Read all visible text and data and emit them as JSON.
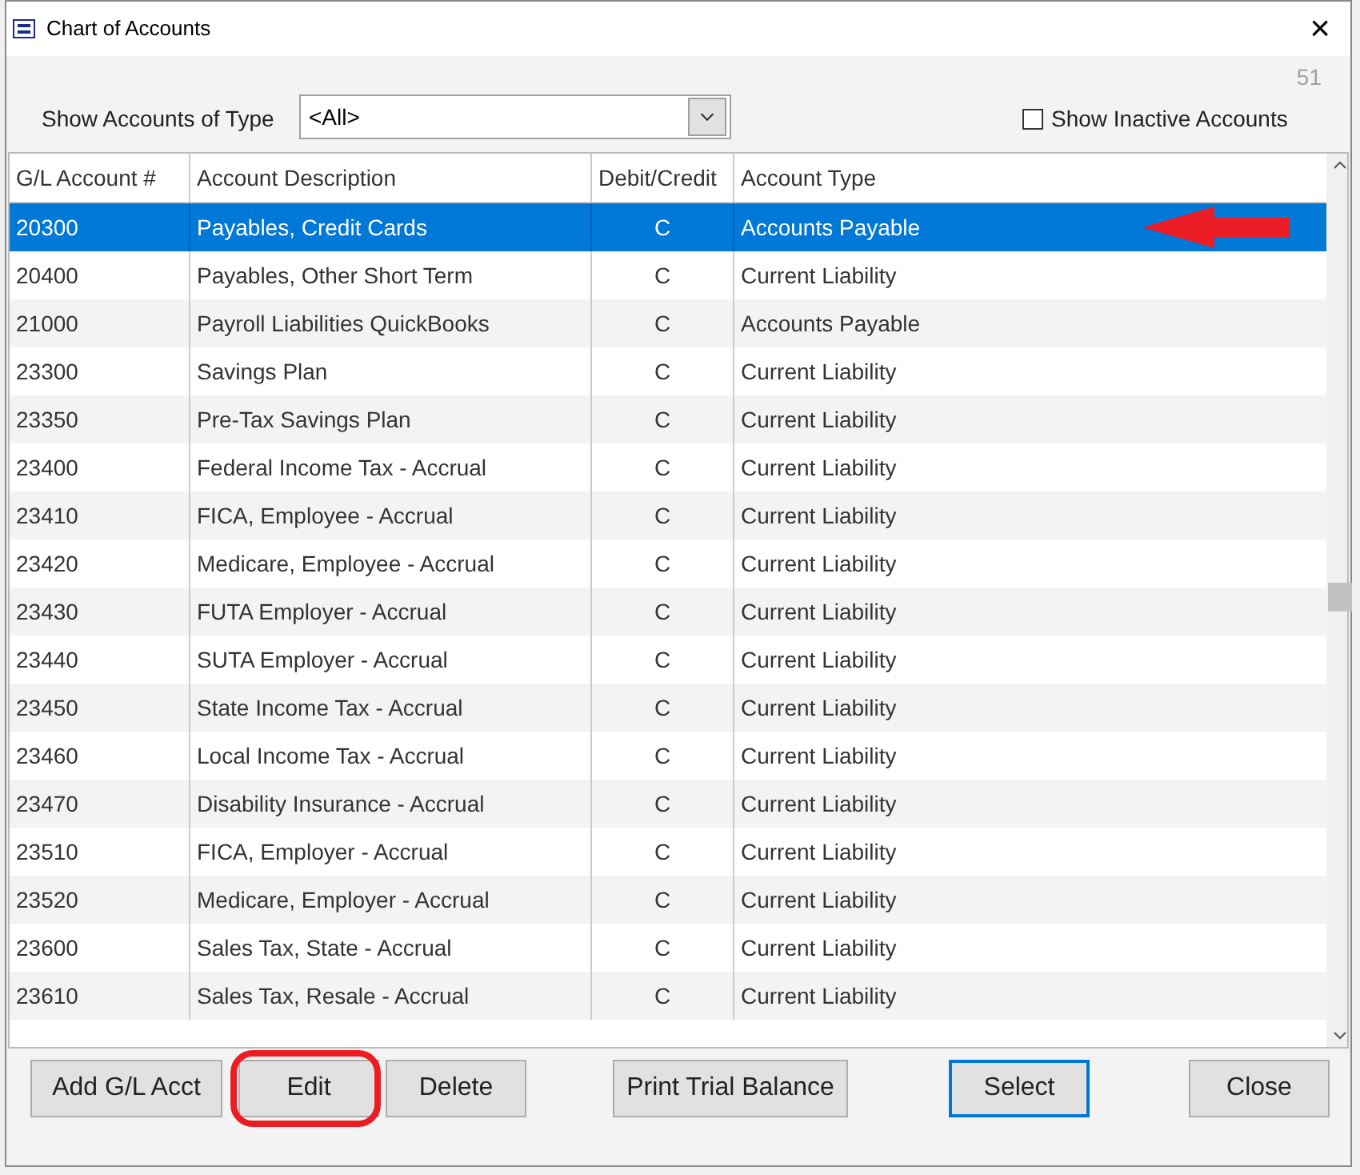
{
  "window": {
    "title": "Chart of Accounts",
    "close": "×"
  },
  "count": "51",
  "filter": {
    "label": "Show Accounts of Type",
    "value": "<All>"
  },
  "show_inactive": {
    "label": "Show Inactive Accounts",
    "checked": false
  },
  "table": {
    "columns": [
      "G/L Account #",
      "Account Description",
      "Debit/Credit",
      "Account Type"
    ],
    "rows": [
      {
        "cells": [
          "20300",
          "Payables, Credit Cards",
          "C",
          "Accounts Payable"
        ],
        "selected": true
      },
      {
        "cells": [
          "20400",
          "Payables, Other Short Term",
          "C",
          "Current Liability"
        ],
        "selected": false
      },
      {
        "cells": [
          "21000",
          "Payroll Liabilities QuickBooks",
          "C",
          "Accounts Payable"
        ],
        "selected": false
      },
      {
        "cells": [
          "23300",
          "Savings Plan",
          "C",
          "Current Liability"
        ],
        "selected": false
      },
      {
        "cells": [
          "23350",
          "Pre-Tax Savings Plan",
          "C",
          "Current Liability"
        ],
        "selected": false
      },
      {
        "cells": [
          "23400",
          "Federal Income Tax - Accrual",
          "C",
          "Current Liability"
        ],
        "selected": false
      },
      {
        "cells": [
          "23410",
          "FICA, Employee - Accrual",
          "C",
          "Current Liability"
        ],
        "selected": false
      },
      {
        "cells": [
          "23420",
          "Medicare, Employee - Accrual",
          "C",
          "Current Liability"
        ],
        "selected": false
      },
      {
        "cells": [
          "23430",
          "FUTA Employer - Accrual",
          "C",
          "Current Liability"
        ],
        "selected": false
      },
      {
        "cells": [
          "23440",
          "SUTA Employer - Accrual",
          "C",
          "Current Liability"
        ],
        "selected": false
      },
      {
        "cells": [
          "23450",
          "State Income Tax - Accrual",
          "C",
          "Current Liability"
        ],
        "selected": false
      },
      {
        "cells": [
          "23460",
          "Local Income Tax - Accrual",
          "C",
          "Current Liability"
        ],
        "selected": false
      },
      {
        "cells": [
          "23470",
          "Disability Insurance - Accrual",
          "C",
          "Current Liability"
        ],
        "selected": false
      },
      {
        "cells": [
          "23510",
          "FICA, Employer - Accrual",
          "C",
          "Current Liability"
        ],
        "selected": false
      },
      {
        "cells": [
          "23520",
          "Medicare, Employer - Accrual",
          "C",
          "Current Liability"
        ],
        "selected": false
      },
      {
        "cells": [
          "23600",
          "Sales Tax, State - Accrual",
          "C",
          "Current Liability"
        ],
        "selected": false
      },
      {
        "cells": [
          "23610",
          "Sales Tax, Resale - Accrual",
          "C",
          "Current Liability"
        ],
        "selected": false
      }
    ]
  },
  "buttons": [
    {
      "label": "Add G/L Acct",
      "default": false
    },
    {
      "label": "Edit",
      "default": false
    },
    {
      "label": "Delete",
      "default": false
    },
    {
      "label": "Print Trial Balance",
      "default": false
    },
    {
      "label": "Select",
      "default": true
    },
    {
      "label": "Close",
      "default": false
    }
  ],
  "annotations": [
    {
      "kind": "arrow"
    },
    {
      "kind": "ring"
    }
  ]
}
